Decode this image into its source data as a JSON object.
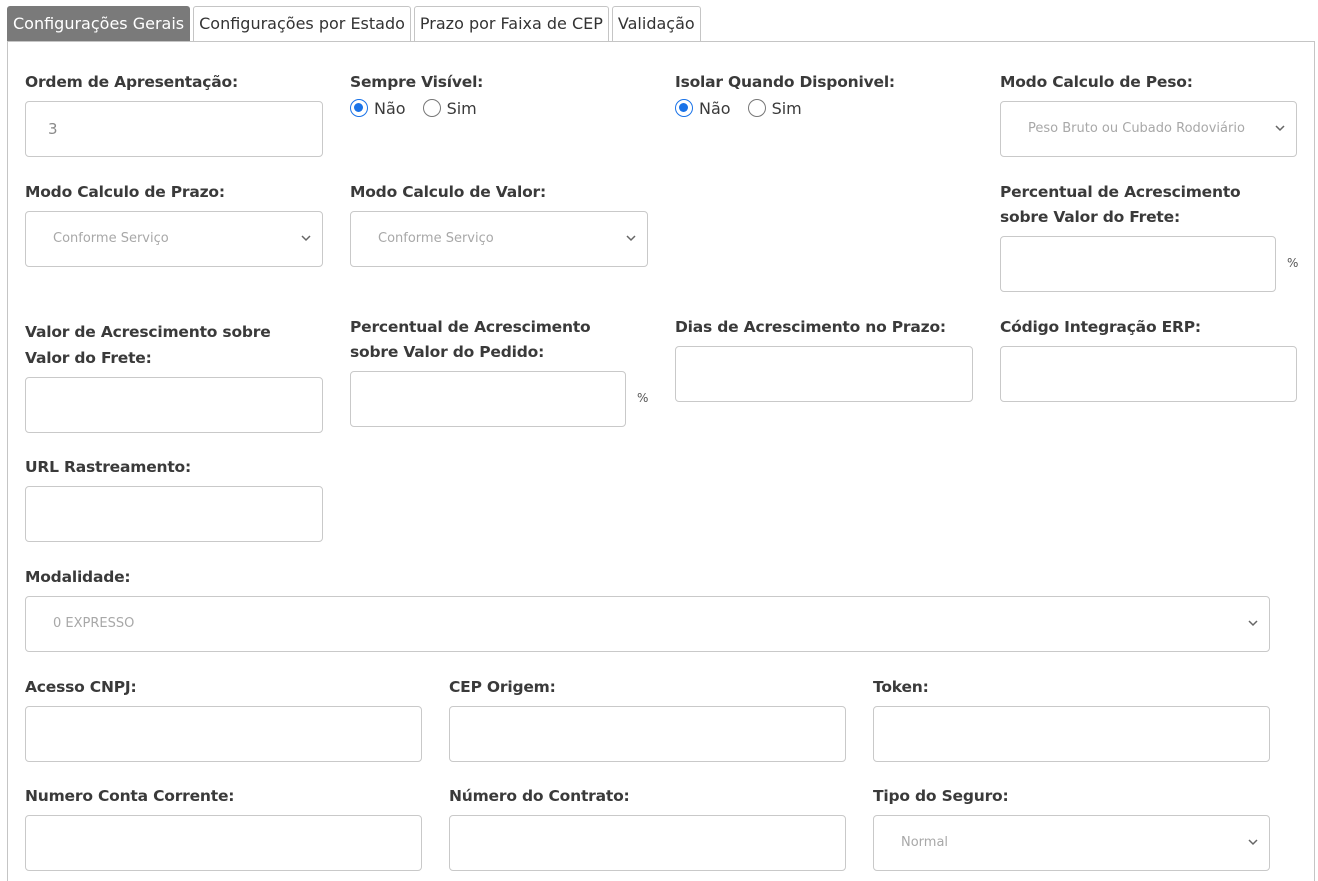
{
  "tabs": [
    {
      "label": "Configurações Gerais"
    },
    {
      "label": "Configurações por Estado"
    },
    {
      "label": "Prazo por Faixa de CEP"
    },
    {
      "label": "Validação"
    }
  ],
  "fields": {
    "ordem_apresentacao": {
      "label": "Ordem de Apresentação:",
      "value": "3"
    },
    "sempre_visivel": {
      "label": "Sempre Visível:",
      "options": [
        "Não",
        "Sim"
      ],
      "selected": "Não"
    },
    "isolar_disponivel": {
      "label": "Isolar Quando Disponivel:",
      "options": [
        "Não",
        "Sim"
      ],
      "selected": "Não"
    },
    "modo_calculo_peso": {
      "label": "Modo Calculo de Peso:",
      "value": "Peso Bruto ou Cubado Rodoviário"
    },
    "modo_calculo_prazo": {
      "label": "Modo Calculo de Prazo:",
      "value": "Conforme Serviço"
    },
    "modo_calculo_valor": {
      "label": "Modo Calculo de Valor:",
      "value": "Conforme Serviço"
    },
    "percentual_frete": {
      "label_line1": "Percentual de Acrescimento",
      "label_line2": "sobre Valor do Frete:",
      "value": "",
      "suffix": "%"
    },
    "valor_frete": {
      "label_line1": "Valor de Acrescimento sobre",
      "label_line2": "Valor do Frete:",
      "value": ""
    },
    "percentual_pedido": {
      "label_line1": "Percentual de Acrescimento",
      "label_line2": "sobre Valor do Pedido:",
      "value": "",
      "suffix": "%"
    },
    "dias_prazo": {
      "label": "Dias de Acrescimento no Prazo:",
      "value": ""
    },
    "codigo_erp": {
      "label": "Código Integração ERP:",
      "value": ""
    },
    "url_rastreamento": {
      "label": "URL Rastreamento:",
      "value": ""
    },
    "modalidade": {
      "label": "Modalidade:",
      "value": "0 EXPRESSO"
    },
    "acesso_cnpj": {
      "label": "Acesso CNPJ:",
      "value": ""
    },
    "cep_origem": {
      "label": "CEP Origem:",
      "value": ""
    },
    "token": {
      "label": "Token:",
      "value": ""
    },
    "numero_conta": {
      "label": "Numero Conta Corrente:",
      "value": ""
    },
    "numero_contrato": {
      "label": "Número do Contrato:",
      "value": ""
    },
    "tipo_seguro": {
      "label": "Tipo do Seguro:",
      "value": "Normal"
    }
  },
  "colors": {
    "active_tab": "#7a7a7a",
    "radio_checked": "#1a73e8",
    "border": "#c9c9c9"
  }
}
